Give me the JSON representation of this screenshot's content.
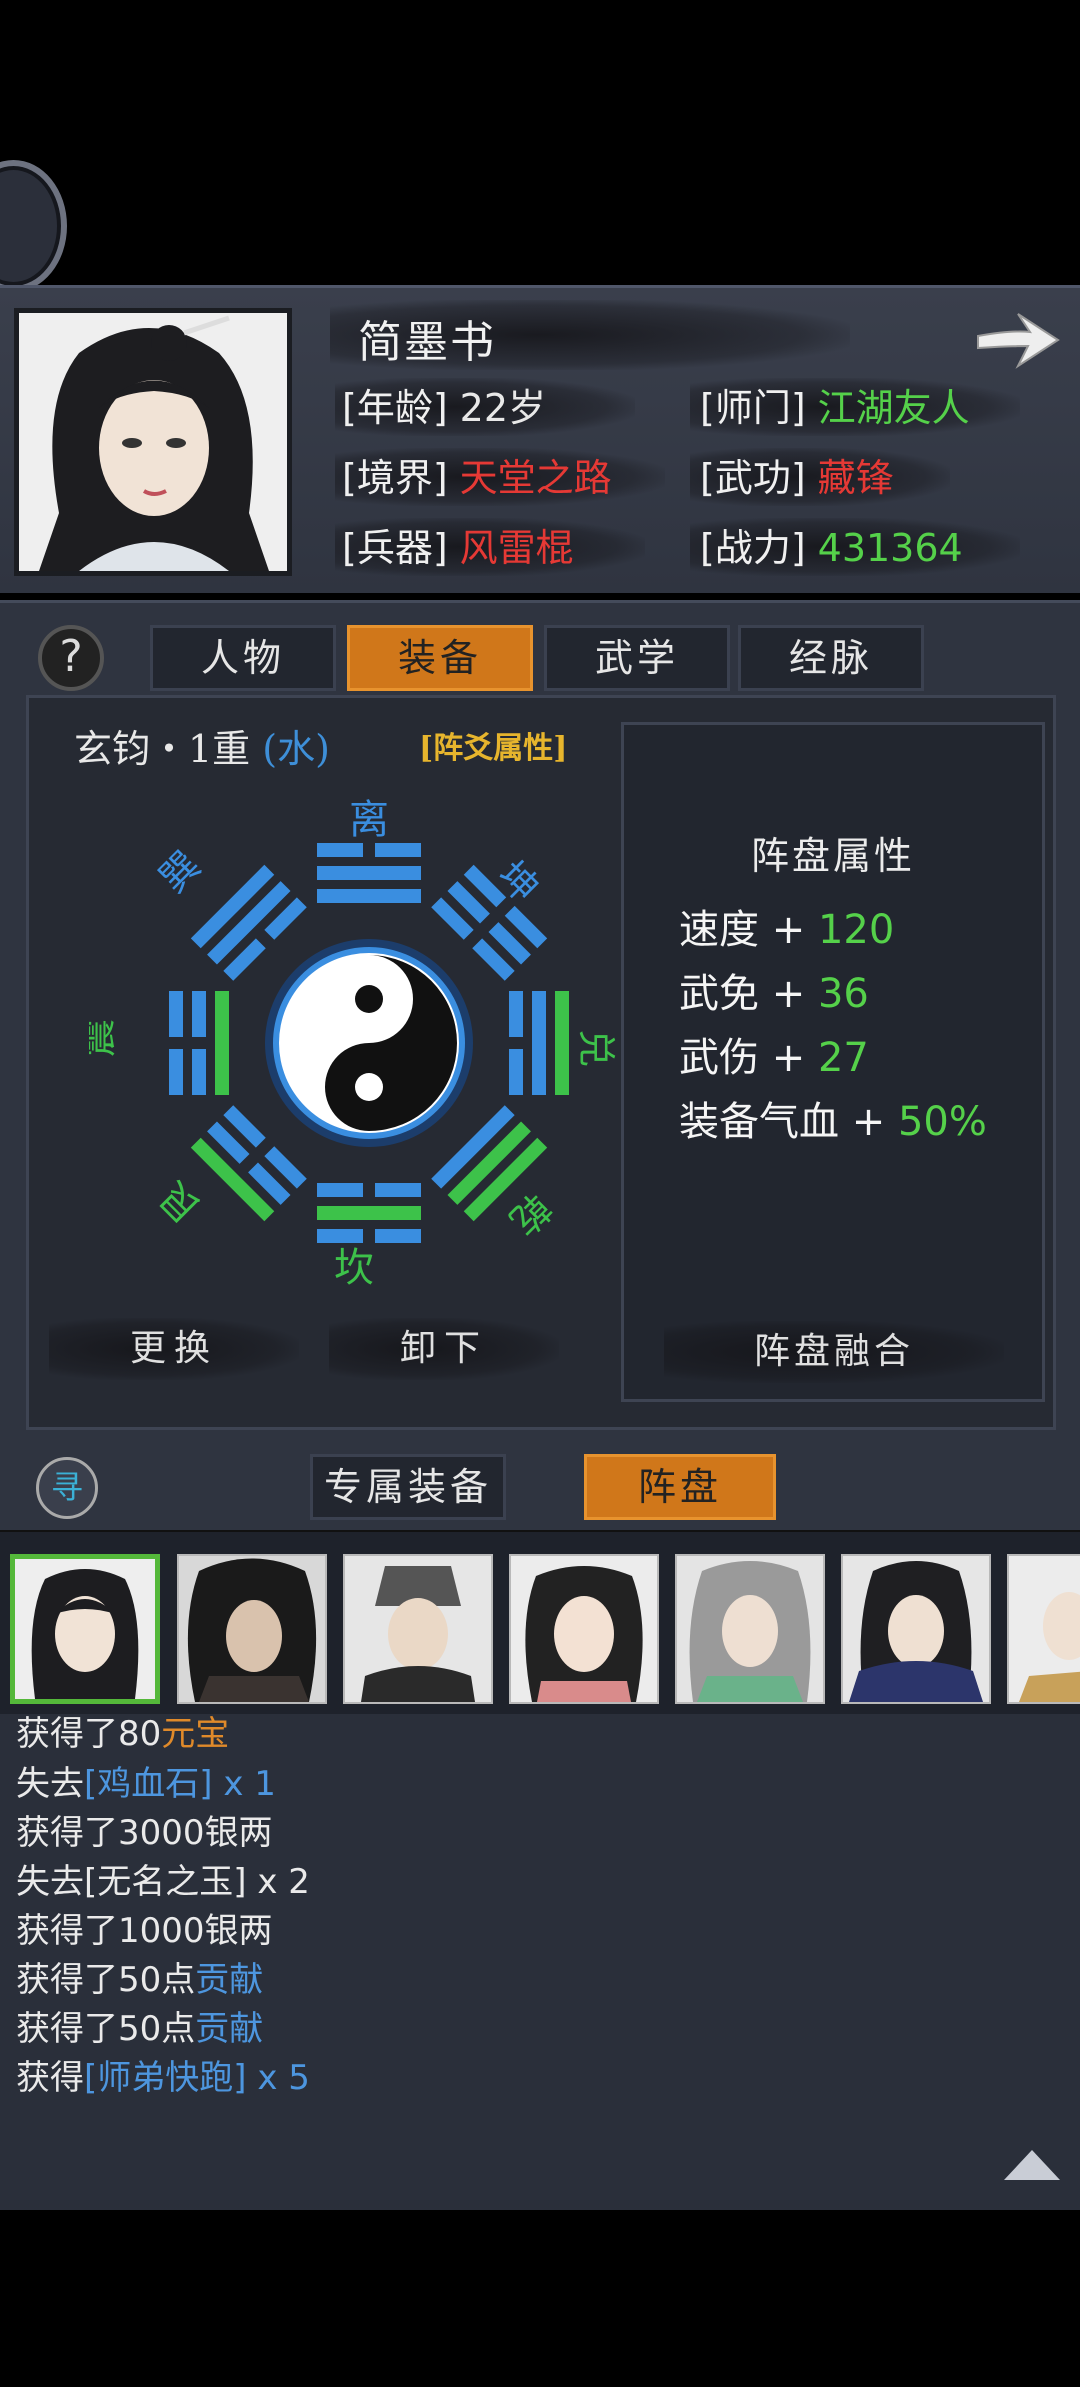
{
  "profile": {
    "name": "简墨书",
    "stats": [
      {
        "label": "[年龄]",
        "value": "22岁",
        "color": "#e8e8e8"
      },
      {
        "label": "[师门]",
        "value": "江湖友人",
        "color": "#55d14a"
      },
      {
        "label": "[境界]",
        "value": "天堂之路",
        "color": "#e53935"
      },
      {
        "label": "[武功]",
        "value": "藏锋",
        "color": "#e53935"
      },
      {
        "label": "[兵器]",
        "value": "风雷棍",
        "color": "#e53935"
      },
      {
        "label": "[战力]",
        "value": "431364",
        "color": "#55d14a"
      }
    ]
  },
  "tabs": {
    "help": "?",
    "items": [
      "人物",
      "装备",
      "武学",
      "经脉"
    ],
    "active": "装备"
  },
  "formation": {
    "name": "玄钧・1重",
    "element": "(水)",
    "tag": "[阵爻属性]",
    "trigrams": [
      "离",
      "坤",
      "兑",
      "乾",
      "坎",
      "艮",
      "震",
      "巽"
    ],
    "colors": {
      "blue": "#3a8ee0",
      "green": "#3dc24a"
    }
  },
  "attributes": {
    "title": "阵盘属性",
    "items": [
      {
        "name": "速度 + ",
        "value": "120"
      },
      {
        "name": "武免 + ",
        "value": "36"
      },
      {
        "name": "武伤 + ",
        "value": "27"
      },
      {
        "name": "装备气血 + ",
        "value": "50%"
      }
    ]
  },
  "buttons": {
    "replace": "更换",
    "unequip": "卸下",
    "fuse": "阵盘融合"
  },
  "subtabs": {
    "coin": "寻",
    "exclusive": "专属装备",
    "formation": "阵盘"
  },
  "log": [
    {
      "prefix": "获得了80",
      "item": "元宝",
      "suffix": "",
      "item_color": "orange"
    },
    {
      "prefix": "失去",
      "item": "[鸡血石] x 1",
      "suffix": "",
      "item_color": "blue"
    },
    {
      "prefix": "获得了3000银两",
      "item": "",
      "suffix": "",
      "item_color": "none"
    },
    {
      "prefix": "失去[无名之玉] x 2",
      "item": "",
      "suffix": "",
      "item_color": "none"
    },
    {
      "prefix": "获得了1000银两",
      "item": "",
      "suffix": "",
      "item_color": "none"
    },
    {
      "prefix": "获得了50点",
      "item": "贡献",
      "suffix": "",
      "item_color": "blue"
    },
    {
      "prefix": "获得了50点",
      "item": "贡献",
      "suffix": "",
      "item_color": "blue"
    },
    {
      "prefix": "获得",
      "item": "[师弟快跑] x 5",
      "suffix": "",
      "item_color": "blue"
    }
  ]
}
